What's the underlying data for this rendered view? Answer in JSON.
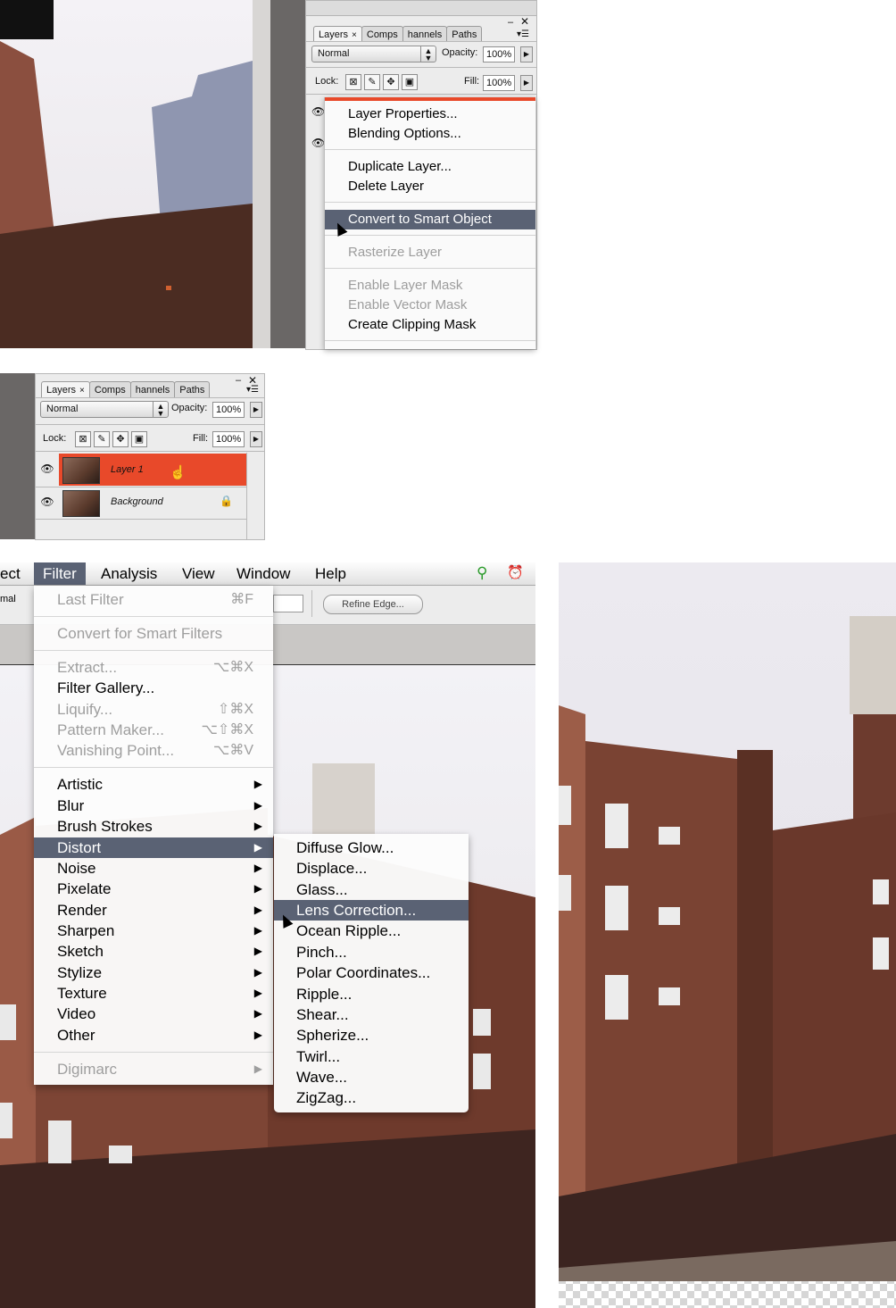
{
  "top_panel": {
    "tabs": [
      {
        "label": "Layers",
        "close": "×",
        "active": true
      },
      {
        "label": "Comps",
        "active": false
      },
      {
        "label": "hannels",
        "active": false
      },
      {
        "label": "Paths",
        "active": false
      }
    ],
    "blend_mode": "Normal",
    "opacity_label": "Opacity:",
    "opacity_value": "100%",
    "lock_label": "Lock:",
    "fill_label": "Fill:",
    "fill_value": "100%"
  },
  "context_menu": {
    "items": [
      {
        "label": "Layer Properties...",
        "enabled": true
      },
      {
        "label": "Blending Options...",
        "enabled": true
      },
      {
        "label": "Duplicate Layer...",
        "enabled": true
      },
      {
        "label": "Delete Layer",
        "enabled": true
      },
      {
        "label": "Convert to Smart Object",
        "enabled": true,
        "highlighted": true
      },
      {
        "label": "Rasterize Layer",
        "enabled": false
      },
      {
        "label": "Enable Layer Mask",
        "enabled": false
      },
      {
        "label": "Enable Vector Mask",
        "enabled": false
      },
      {
        "label": "Create Clipping Mask",
        "enabled": true
      }
    ]
  },
  "mid_panel": {
    "tabs": [
      {
        "label": "Layers",
        "close": "×",
        "active": true
      },
      {
        "label": "Comps",
        "active": false
      },
      {
        "label": "hannels",
        "active": false
      },
      {
        "label": "Paths",
        "active": false
      }
    ],
    "blend_mode": "Normal",
    "opacity_label": "Opacity:",
    "opacity_value": "100%",
    "lock_label": "Lock:",
    "fill_label": "Fill:",
    "fill_value": "100%",
    "layers": [
      {
        "name": "Layer 1",
        "selected": true
      },
      {
        "name": "Background",
        "selected": false,
        "locked": true
      }
    ]
  },
  "menubar": {
    "items": [
      "ect",
      "Filter",
      "Analysis",
      "View",
      "Window",
      "Help"
    ],
    "active": "Filter",
    "options_left": "mal",
    "refine_edge": "Refine Edge..."
  },
  "filter_menu": {
    "items": [
      {
        "label": "Last Filter",
        "shortcut": "⌘F",
        "enabled": false
      },
      {
        "label": "Convert for Smart Filters",
        "enabled": false
      },
      {
        "label": "Extract...",
        "shortcut": "⌥⌘X",
        "enabled": false
      },
      {
        "label": "Filter Gallery...",
        "enabled": true
      },
      {
        "label": "Liquify...",
        "shortcut": "⇧⌘X",
        "enabled": false
      },
      {
        "label": "Pattern Maker...",
        "shortcut": "⌥⇧⌘X",
        "enabled": false
      },
      {
        "label": "Vanishing Point...",
        "shortcut": "⌥⌘V",
        "enabled": false
      },
      {
        "label": "Artistic",
        "submenu": true,
        "enabled": true
      },
      {
        "label": "Blur",
        "submenu": true,
        "enabled": true
      },
      {
        "label": "Brush Strokes",
        "submenu": true,
        "enabled": true
      },
      {
        "label": "Distort",
        "submenu": true,
        "enabled": true,
        "highlighted": true
      },
      {
        "label": "Noise",
        "submenu": true,
        "enabled": true
      },
      {
        "label": "Pixelate",
        "submenu": true,
        "enabled": true
      },
      {
        "label": "Render",
        "submenu": true,
        "enabled": true
      },
      {
        "label": "Sharpen",
        "submenu": true,
        "enabled": true
      },
      {
        "label": "Sketch",
        "submenu": true,
        "enabled": true
      },
      {
        "label": "Stylize",
        "submenu": true,
        "enabled": true
      },
      {
        "label": "Texture",
        "submenu": true,
        "enabled": true
      },
      {
        "label": "Video",
        "submenu": true,
        "enabled": true
      },
      {
        "label": "Other",
        "submenu": true,
        "enabled": true
      },
      {
        "label": "Digimarc",
        "submenu": true,
        "enabled": false
      }
    ],
    "submenu_arrow": "▶"
  },
  "distort_submenu": {
    "items": [
      {
        "label": "Diffuse Glow..."
      },
      {
        "label": "Displace..."
      },
      {
        "label": "Glass..."
      },
      {
        "label": "Lens Correction...",
        "highlighted": true
      },
      {
        "label": "Ocean Ripple..."
      },
      {
        "label": "Pinch..."
      },
      {
        "label": "Polar Coordinates..."
      },
      {
        "label": "Ripple..."
      },
      {
        "label": "Shear..."
      },
      {
        "label": "Spherize..."
      },
      {
        "label": "Twirl..."
      },
      {
        "label": "Wave..."
      },
      {
        "label": "ZigZag..."
      }
    ]
  },
  "icons": {
    "eye": "👁",
    "lock": "🔒",
    "pin": "⚲",
    "clock": "⏰"
  },
  "colors": {
    "highlight": "#5a6274",
    "selected_layer": "#e8492a"
  }
}
